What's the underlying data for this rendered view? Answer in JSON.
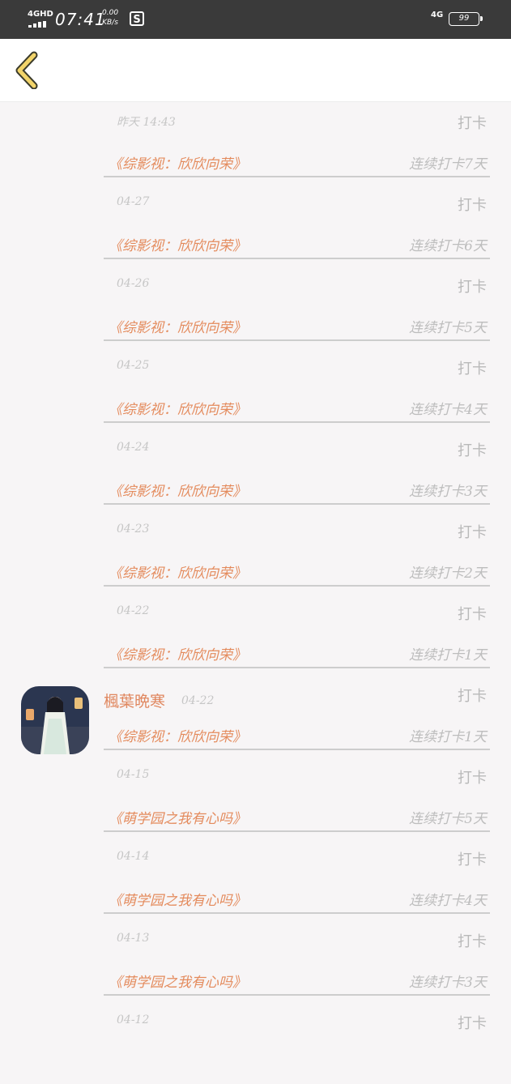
{
  "status_bar": {
    "network": "4GHD",
    "time": "07:41",
    "speed_value": "0.00",
    "speed_unit": "KB/s",
    "app_icon": "S",
    "network_right": "4G",
    "battery": "99"
  },
  "header": {
    "back_icon": "chevron-left-icon"
  },
  "entries": [
    {
      "date": "昨天 14:43",
      "action": "打卡",
      "book": "《综影视：欣欣向荣》",
      "streak": "连续打卡7天"
    },
    {
      "date": "04-27",
      "action": "打卡",
      "book": "《综影视：欣欣向荣》",
      "streak": "连续打卡6天"
    },
    {
      "date": "04-26",
      "action": "打卡",
      "book": "《综影视：欣欣向荣》",
      "streak": "连续打卡5天"
    },
    {
      "date": "04-25",
      "action": "打卡",
      "book": "《综影视：欣欣向荣》",
      "streak": "连续打卡4天"
    },
    {
      "date": "04-24",
      "action": "打卡",
      "book": "《综影视：欣欣向荣》",
      "streak": "连续打卡3天"
    },
    {
      "date": "04-23",
      "action": "打卡",
      "book": "《综影视：欣欣向荣》",
      "streak": "连续打卡2天"
    },
    {
      "date": "04-22",
      "action": "打卡",
      "book": "《综影视：欣欣向荣》",
      "streak": "连续打卡1天"
    },
    {
      "username": "楓葉晩寒",
      "date": "04-22",
      "action": "打卡",
      "book": "《综影视：欣欣向荣》",
      "streak": "连续打卡1天"
    },
    {
      "date": "04-15",
      "action": "打卡",
      "book": "《萌学园之我有心吗》",
      "streak": "连续打卡5天"
    },
    {
      "date": "04-14",
      "action": "打卡",
      "book": "《萌学园之我有心吗》",
      "streak": "连续打卡4天"
    },
    {
      "date": "04-13",
      "action": "打卡",
      "book": "《萌学园之我有心吗》",
      "streak": "连续打卡3天"
    },
    {
      "date": "04-12",
      "action": "打卡",
      "book": "",
      "streak": ""
    }
  ]
}
